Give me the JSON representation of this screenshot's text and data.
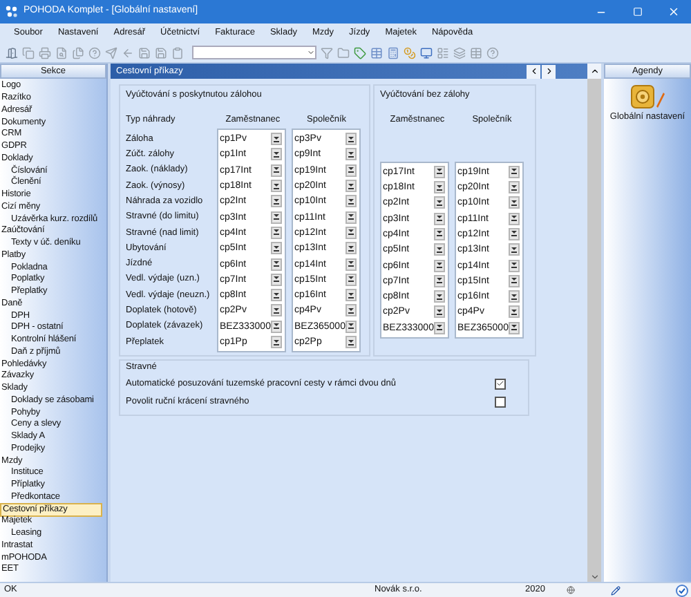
{
  "window": {
    "title": "POHODA Komplet - [Globální nastavení]"
  },
  "menu": [
    {
      "label": "Soubor"
    },
    {
      "label": "Nastavení"
    },
    {
      "label": "Adresář"
    },
    {
      "label": "Účetnictví"
    },
    {
      "label": "Fakturace"
    },
    {
      "label": "Sklady"
    },
    {
      "label": "Mzdy"
    },
    {
      "label": "Jízdy"
    },
    {
      "label": "Majetek"
    },
    {
      "label": "Nápověda"
    }
  ],
  "sidebar": {
    "title": "Sekce",
    "items": [
      {
        "label": "Logo",
        "selected": false
      },
      {
        "label": "Razítko",
        "selected": false
      },
      {
        "label": "Adresář",
        "selected": false
      },
      {
        "label": "Dokumenty",
        "selected": false
      },
      {
        "label": "CRM",
        "selected": false
      },
      {
        "label": "GDPR",
        "selected": false
      },
      {
        "label": "Doklady",
        "selected": false,
        "children": [
          {
            "label": "Číslování",
            "selected": false
          },
          {
            "label": "Členění",
            "selected": false
          }
        ]
      },
      {
        "label": "Historie",
        "selected": false
      },
      {
        "label": "Cizí měny",
        "selected": false,
        "children": [
          {
            "label": "Uzávěrka kurz. rozdílů",
            "selected": false
          }
        ]
      },
      {
        "label": "Zaúčtování",
        "selected": false,
        "children": [
          {
            "label": "Texty v úč. deníku",
            "selected": false
          }
        ]
      },
      {
        "label": "Platby",
        "selected": false,
        "children": [
          {
            "label": "Pokladna",
            "selected": false
          },
          {
            "label": "Poplatky",
            "selected": false
          },
          {
            "label": "Přeplatky",
            "selected": false
          }
        ]
      },
      {
        "label": "Daně",
        "selected": false,
        "children": [
          {
            "label": "DPH",
            "selected": false
          },
          {
            "label": "DPH - ostatní",
            "selected": false
          },
          {
            "label": "Kontrolní hlášení",
            "selected": false
          },
          {
            "label": "Daň z příjmů",
            "selected": false
          }
        ]
      },
      {
        "label": "Pohledávky",
        "selected": false
      },
      {
        "label": "Závazky",
        "selected": false
      },
      {
        "label": "Sklady",
        "selected": false,
        "children": [
          {
            "label": "Doklady se zásobami",
            "selected": false
          },
          {
            "label": "Pohyby",
            "selected": false
          },
          {
            "label": "Ceny a slevy",
            "selected": false
          },
          {
            "label": "Sklady A",
            "selected": false
          },
          {
            "label": "Prodejky",
            "selected": false
          }
        ]
      },
      {
        "label": "Mzdy",
        "selected": false,
        "children": [
          {
            "label": "Instituce",
            "selected": false
          },
          {
            "label": "Příplatky",
            "selected": false
          },
          {
            "label": "Předkontace",
            "selected": false
          }
        ]
      },
      {
        "label": "Cestovní příkazy",
        "selected": true
      },
      {
        "label": "Majetek",
        "selected": false,
        "children": [
          {
            "label": "Leasing",
            "selected": false
          }
        ]
      },
      {
        "label": "Intrastat",
        "selected": false
      },
      {
        "label": "mPOHODA",
        "selected": false
      },
      {
        "label": "EET",
        "selected": false
      }
    ]
  },
  "panel": {
    "title": "Cestovní příkazy",
    "with_advance": {
      "title": "Vyúčtování s poskytnutou zálohou",
      "type_header": "Typ náhrady",
      "columns": [
        "Zaměstnanec",
        "Společník"
      ]
    },
    "without_advance": {
      "title": "Vyúčtování bez zálohy",
      "columns": [
        "Zaměstnanec",
        "Společník"
      ]
    },
    "rows": [
      {
        "label": "Záloha",
        "with_advance": [
          "cp1Pv",
          "cp3Pv"
        ]
      },
      {
        "label": "Zúčt. zálohy",
        "with_advance": [
          "cp1Int",
          "cp9Int"
        ]
      },
      {
        "label": "Zaok. (náklady)",
        "with_advance": [
          "cp17Int",
          "cp19Int"
        ],
        "without_advance": [
          "cp17Int",
          "cp19Int"
        ]
      },
      {
        "label": "Zaok. (výnosy)",
        "with_advance": [
          "cp18Int",
          "cp20Int"
        ],
        "without_advance": [
          "cp18Int",
          "cp20Int"
        ]
      },
      {
        "label": "Náhrada za vozidlo",
        "with_advance": [
          "cp2Int",
          "cp10Int"
        ],
        "without_advance": [
          "cp2Int",
          "cp10Int"
        ]
      },
      {
        "label": "Stravné (do limitu)",
        "with_advance": [
          "cp3Int",
          "cp11Int"
        ],
        "without_advance": [
          "cp3Int",
          "cp11Int"
        ]
      },
      {
        "label": "Stravné (nad limit)",
        "with_advance": [
          "cp4Int",
          "cp12Int"
        ],
        "without_advance": [
          "cp4Int",
          "cp12Int"
        ]
      },
      {
        "label": "Ubytování",
        "with_advance": [
          "cp5Int",
          "cp13Int"
        ],
        "without_advance": [
          "cp5Int",
          "cp13Int"
        ]
      },
      {
        "label": "Jízdné",
        "with_advance": [
          "cp6Int",
          "cp14Int"
        ],
        "without_advance": [
          "cp6Int",
          "cp14Int"
        ]
      },
      {
        "label": "Vedl. výdaje (uzn.)",
        "with_advance": [
          "cp7Int",
          "cp15Int"
        ],
        "without_advance": [
          "cp7Int",
          "cp15Int"
        ]
      },
      {
        "label": "Vedl. výdaje (neuzn.)",
        "with_advance": [
          "cp8Int",
          "cp16Int"
        ],
        "without_advance": [
          "cp8Int",
          "cp16Int"
        ]
      },
      {
        "label": "Doplatek (hotově)",
        "with_advance": [
          "cp2Pv",
          "cp4Pv"
        ],
        "without_advance": [
          "cp2Pv",
          "cp4Pv"
        ]
      },
      {
        "label": "Doplatek (závazek)",
        "with_advance": [
          "BEZ333000",
          "BEZ365000"
        ],
        "without_advance": [
          "BEZ333000",
          "BEZ365000"
        ]
      },
      {
        "label": "Přeplatek",
        "with_advance": [
          "cp1Pp",
          "cp2Pp"
        ]
      }
    ],
    "meal": {
      "title": "Stravné",
      "options": [
        {
          "label": "Automatické posuzování tuzemské pracovní cesty v rámci dvou dnů",
          "checked": true
        },
        {
          "label": "Povolit ruční krácení stravného",
          "checked": false
        }
      ]
    }
  },
  "agendas": {
    "title": "Agendy",
    "items": [
      {
        "label": "Globální nastavení"
      }
    ]
  },
  "status_bar": {
    "message": "OK",
    "company": "Novák s.r.o.",
    "year": "2020"
  }
}
